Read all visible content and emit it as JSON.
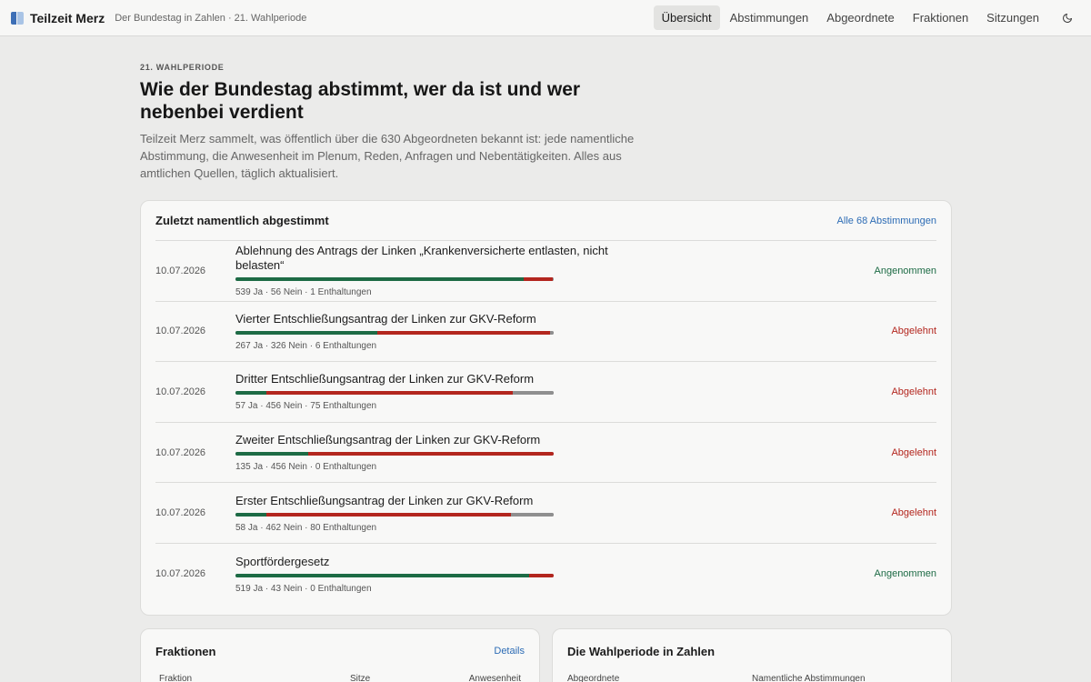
{
  "app": {
    "brand": "Teilzeit Merz",
    "tagline": "Der Bundestag in Zahlen · 21. Wahlperiode"
  },
  "nav": {
    "items": [
      {
        "label": "Übersicht",
        "active": true
      },
      {
        "label": "Abstimmungen",
        "active": false
      },
      {
        "label": "Abgeordnete",
        "active": false
      },
      {
        "label": "Fraktionen",
        "active": false
      },
      {
        "label": "Sitzungen",
        "active": false
      }
    ],
    "theme_icon": "moon-icon"
  },
  "hero": {
    "kicker": "21. WAHLPERIODE",
    "title": "Wie der Bundestag abstimmt, wer da ist und wer nebenbei verdient",
    "intro": "Teilzeit Merz sammelt, was öffentlich über die 630 Abgeordneten bekannt ist: jede namentliche Abstimmung, die Anwesenheit im Plenum, Reden, Anfragen und Nebentätigkeiten. Alles aus amtlichen Quellen, täglich aktualisiert."
  },
  "votes_card": {
    "title": "Zuletzt namentlich abgestimmt",
    "link": "Alle 68 Abstimmungen",
    "rows": [
      {
        "date": "10.07.2026",
        "title": "Ablehnung des Antrags der Linken „Krankenversicherte entlasten, nicht belasten“",
        "ja": 539,
        "nein": 56,
        "enth": 1,
        "counts": "539 Ja · 56 Nein · 1 Enthaltungen",
        "result": "Angenommen",
        "passed": true
      },
      {
        "date": "10.07.2026",
        "title": "Vierter Entschließungsantrag der Linken zur GKV-Reform",
        "ja": 267,
        "nein": 326,
        "enth": 6,
        "counts": "267 Ja · 326 Nein · 6 Enthaltungen",
        "result": "Abgelehnt",
        "passed": false
      },
      {
        "date": "10.07.2026",
        "title": "Dritter Entschließungsantrag der Linken zur GKV-Reform",
        "ja": 57,
        "nein": 456,
        "enth": 75,
        "counts": "57 Ja · 456 Nein · 75 Enthaltungen",
        "result": "Abgelehnt",
        "passed": false
      },
      {
        "date": "10.07.2026",
        "title": "Zweiter Entschließungsantrag der Linken zur GKV-Reform",
        "ja": 135,
        "nein": 456,
        "enth": 0,
        "counts": "135 Ja · 456 Nein · 0 Enthaltungen",
        "result": "Abgelehnt",
        "passed": false
      },
      {
        "date": "10.07.2026",
        "title": "Erster Entschließungsantrag der Linken zur GKV-Reform",
        "ja": 58,
        "nein": 462,
        "enth": 80,
        "counts": "58 Ja · 462 Nein · 80 Enthaltungen",
        "result": "Abgelehnt",
        "passed": false
      },
      {
        "date": "10.07.2026",
        "title": "Sportfördergesetz",
        "ja": 519,
        "nein": 43,
        "enth": 0,
        "counts": "519 Ja · 43 Nein · 0 Enthaltungen",
        "result": "Angenommen",
        "passed": true
      }
    ]
  },
  "fraktionen_card": {
    "title": "Fraktionen",
    "link": "Details",
    "columns": [
      "Fraktion",
      "Sitze",
      "Anwesenheit"
    ]
  },
  "stats_card": {
    "title": "Die Wahlperiode in Zahlen",
    "labels": [
      "Abgeordnete",
      "Namentliche Abstimmungen"
    ]
  },
  "colors": {
    "ja": "#1d6b45",
    "nein": "#b3261e",
    "enthaltung": "#8f8f8f",
    "link": "#2d6cb5"
  }
}
